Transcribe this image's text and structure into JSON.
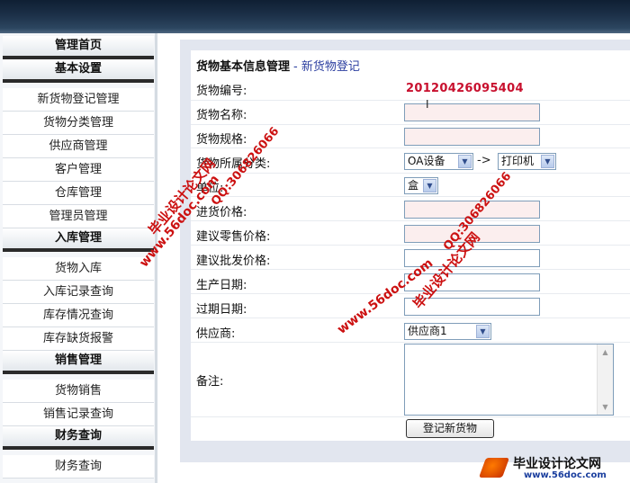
{
  "sidebar": {
    "items": [
      {
        "label": "管理首页",
        "type": "head"
      },
      {
        "label": "基本设置",
        "type": "head"
      },
      {
        "label": "新货物登记管理",
        "type": "item"
      },
      {
        "label": "货物分类管理",
        "type": "item"
      },
      {
        "label": "供应商管理",
        "type": "item"
      },
      {
        "label": "客户管理",
        "type": "item"
      },
      {
        "label": "仓库管理",
        "type": "item"
      },
      {
        "label": "管理员管理",
        "type": "item"
      },
      {
        "label": "入库管理",
        "type": "head"
      },
      {
        "label": "货物入库",
        "type": "item"
      },
      {
        "label": "入库记录查询",
        "type": "item"
      },
      {
        "label": "库存情况查询",
        "type": "item"
      },
      {
        "label": "库存缺货报警",
        "type": "item"
      },
      {
        "label": "销售管理",
        "type": "head"
      },
      {
        "label": "货物销售",
        "type": "item"
      },
      {
        "label": "销售记录查询",
        "type": "item"
      },
      {
        "label": "财务查询",
        "type": "head"
      },
      {
        "label": "财务查询",
        "type": "item"
      }
    ]
  },
  "form": {
    "title": "货物基本信息管理",
    "subtitle": "- 新货物登记",
    "labels": {
      "code": "货物编号:",
      "name": "货物名称:",
      "spec": "货物规格:",
      "category": "货物所属分类:",
      "unit": "单位:",
      "purchase_price": "进货价格:",
      "retail_price": "建议零售价格:",
      "wholesale_price": "建议批发价格:",
      "production_date": "生产日期:",
      "expiry_date": "过期日期:",
      "supplier": "供应商:",
      "remark": "备注:"
    },
    "code_value": "20120426095404",
    "category_main": "OA设备",
    "category_arrow": "->",
    "category_sub": "打印机",
    "unit_value": "盒",
    "supplier_value": "供应商1",
    "submit_label": "登记新货物"
  },
  "watermarks": {
    "a": "毕业设计论文网",
    "b": "www.56doc.com",
    "c": "QQ:306826066"
  },
  "footer": {
    "brand": "毕业设计论文网",
    "url": "www.56doc.com"
  },
  "colors": {
    "accent": "#2c3fa0",
    "code_red": "#c8102e",
    "watermark_red": "#cc1111"
  }
}
